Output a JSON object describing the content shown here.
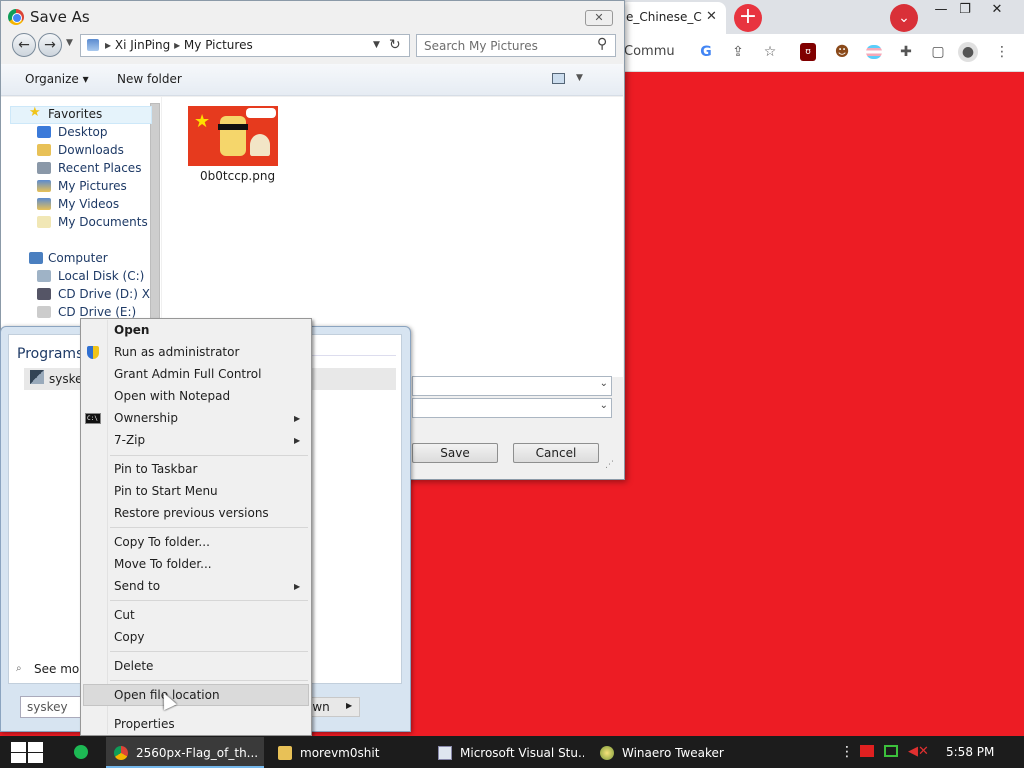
{
  "browser": {
    "tab_title": "e_Chinese_C",
    "tab_close": "✕",
    "new_tab": "+",
    "address_fragment": "Commu",
    "window_controls": [
      "—",
      "❐",
      "✕"
    ],
    "extensions": [
      "google-icon",
      "share-icon",
      "star-icon",
      "ublock-icon",
      "avatar-ext-icon",
      "flag-ext-icon",
      "puzzle-icon",
      "sidepanel-icon",
      "profile-icon",
      "menu-icon"
    ],
    "colors": {
      "page_bg": "#ed1c24",
      "accent": "#e8343f"
    }
  },
  "save_dialog": {
    "title": "Save As",
    "close": "✕",
    "breadcrumb": [
      "Xi JinPing",
      "My Pictures"
    ],
    "breadcrumb_separator": "▸",
    "search_placeholder": "Search My Pictures",
    "toolbar": {
      "organize": "Organize ▾",
      "new_folder": "New folder"
    },
    "nav": {
      "favorites_label": "Favorites",
      "favorites": [
        "Desktop",
        "Downloads",
        "Recent Places",
        "My Pictures",
        "My Videos",
        "My Documents"
      ],
      "computer_label": "Computer",
      "computer": [
        "Local Disk (C:)",
        "CD Drive (D:) X",
        "CD Drive (E:)"
      ]
    },
    "files": [
      {
        "name": "0b0tccp.png"
      }
    ],
    "save_label": "Save",
    "cancel_label": "Cancel"
  },
  "start_menu": {
    "programs_header": "Programs",
    "program_item": "syskey",
    "see_more": "See mo",
    "search_value": "syskey",
    "shutdown_label": "own"
  },
  "context_menu": {
    "items": [
      {
        "label": "Open",
        "bold": true
      },
      {
        "label": "Run as administrator"
      },
      {
        "label": "Grant Admin Full Control"
      },
      {
        "label": "Open with Notepad"
      },
      {
        "label": "Ownership"
      },
      {
        "label": "7-Zip"
      },
      {
        "label": "Pin to Taskbar"
      },
      {
        "label": "Pin to Start Menu"
      },
      {
        "label": "Restore previous versions"
      },
      {
        "label": "Copy To folder..."
      },
      {
        "label": "Move To folder..."
      },
      {
        "label": "Send to"
      },
      {
        "label": "Cut"
      },
      {
        "label": "Copy"
      },
      {
        "label": "Delete"
      },
      {
        "label": "Open file location",
        "highlighted": true
      },
      {
        "label": "Properties"
      }
    ],
    "cmd_icon_text": "C:\\"
  },
  "taskbar": {
    "items": [
      {
        "label": "2560px-Flag_of_th...",
        "icon": "chrome-icon"
      },
      {
        "label": "morevm0shit",
        "icon": "folder-icon"
      },
      {
        "label": "Microsoft Visual Stu...",
        "icon": "visual-studio-icon"
      },
      {
        "label": "Winaero Tweaker",
        "icon": "winaero-icon"
      }
    ],
    "clock": "5:58 PM"
  }
}
